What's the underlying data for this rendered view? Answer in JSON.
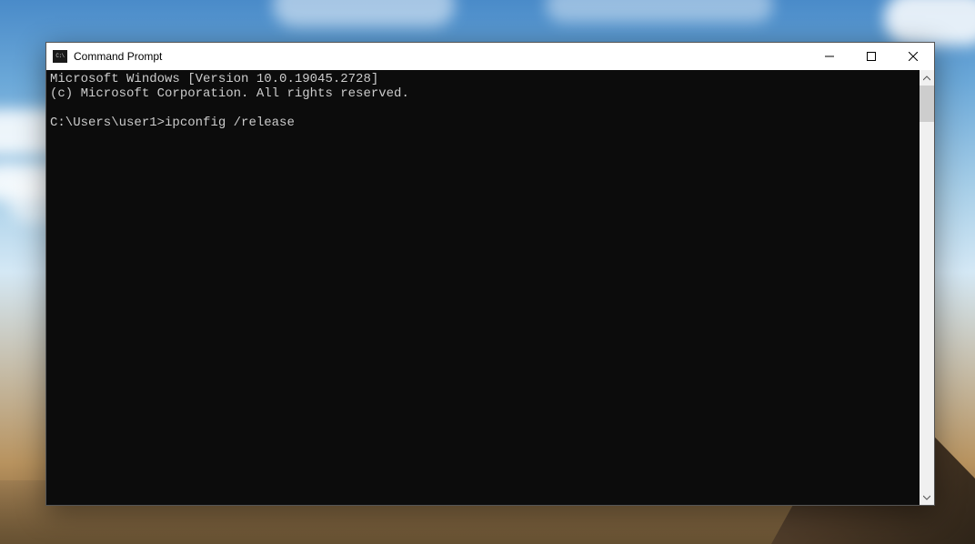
{
  "window": {
    "title": "Command Prompt",
    "controls": {
      "minimize_label": "Minimize",
      "maximize_label": "Maximize",
      "close_label": "Close"
    }
  },
  "terminal": {
    "line1": "Microsoft Windows [Version 10.0.19045.2728]",
    "line2": "(c) Microsoft Corporation. All rights reserved.",
    "blank": "",
    "prompt": "C:\\Users\\user1>",
    "command": "ipconfig /release"
  }
}
